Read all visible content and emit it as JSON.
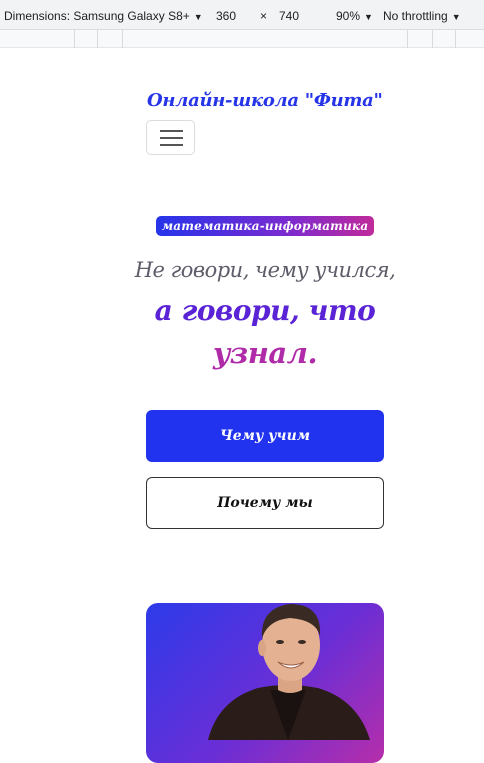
{
  "devtools": {
    "dimensions_label": "Dimensions: Samsung Galaxy S8+",
    "width": "360",
    "times": "×",
    "height": "740",
    "zoom": "90%",
    "throttling": "No throttling"
  },
  "header": {
    "brand": "Онлайн-школа \"Фита\"",
    "menu_icon": "hamburger-icon"
  },
  "hero": {
    "subjects_badge": "математика-информатика",
    "quote_line1": "Не говори, чему учился,",
    "quote_line2": "а говори, что",
    "quote_line3": "узнал.",
    "primary_button": "Чему учим",
    "secondary_button": "Почему мы"
  },
  "colors": {
    "brand": "#2635e8",
    "primary": "#2233f0",
    "purple": "#5a24d6",
    "magenta": "#b02ba8"
  }
}
